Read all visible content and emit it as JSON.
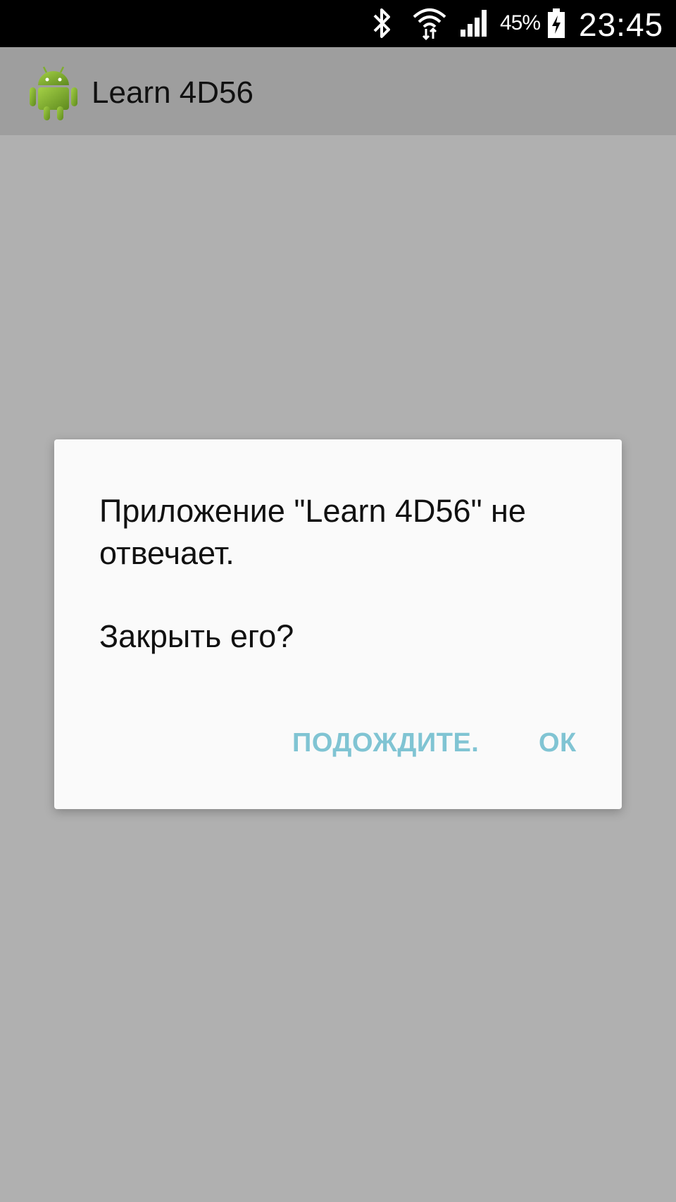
{
  "status_bar": {
    "battery_percent": "45%",
    "time": "23:45",
    "icons": [
      "bluetooth-icon",
      "wifi-icon",
      "signal-icon",
      "battery-icon"
    ]
  },
  "action_bar": {
    "title": "Learn 4D56",
    "icon": "android-icon"
  },
  "dialog": {
    "message": "Приложение \"Learn 4D56\" не отвечает.",
    "question": "Закрыть его?",
    "wait_label": "ПОДОЖДИТЕ.",
    "ok_label": "ОК"
  },
  "colors": {
    "status_bar": "#000000",
    "action_bar": "#9e9e9e",
    "backdrop": "#b0b0b0",
    "dialog_bg": "#fafafa",
    "button_text": "#80c4d3"
  }
}
